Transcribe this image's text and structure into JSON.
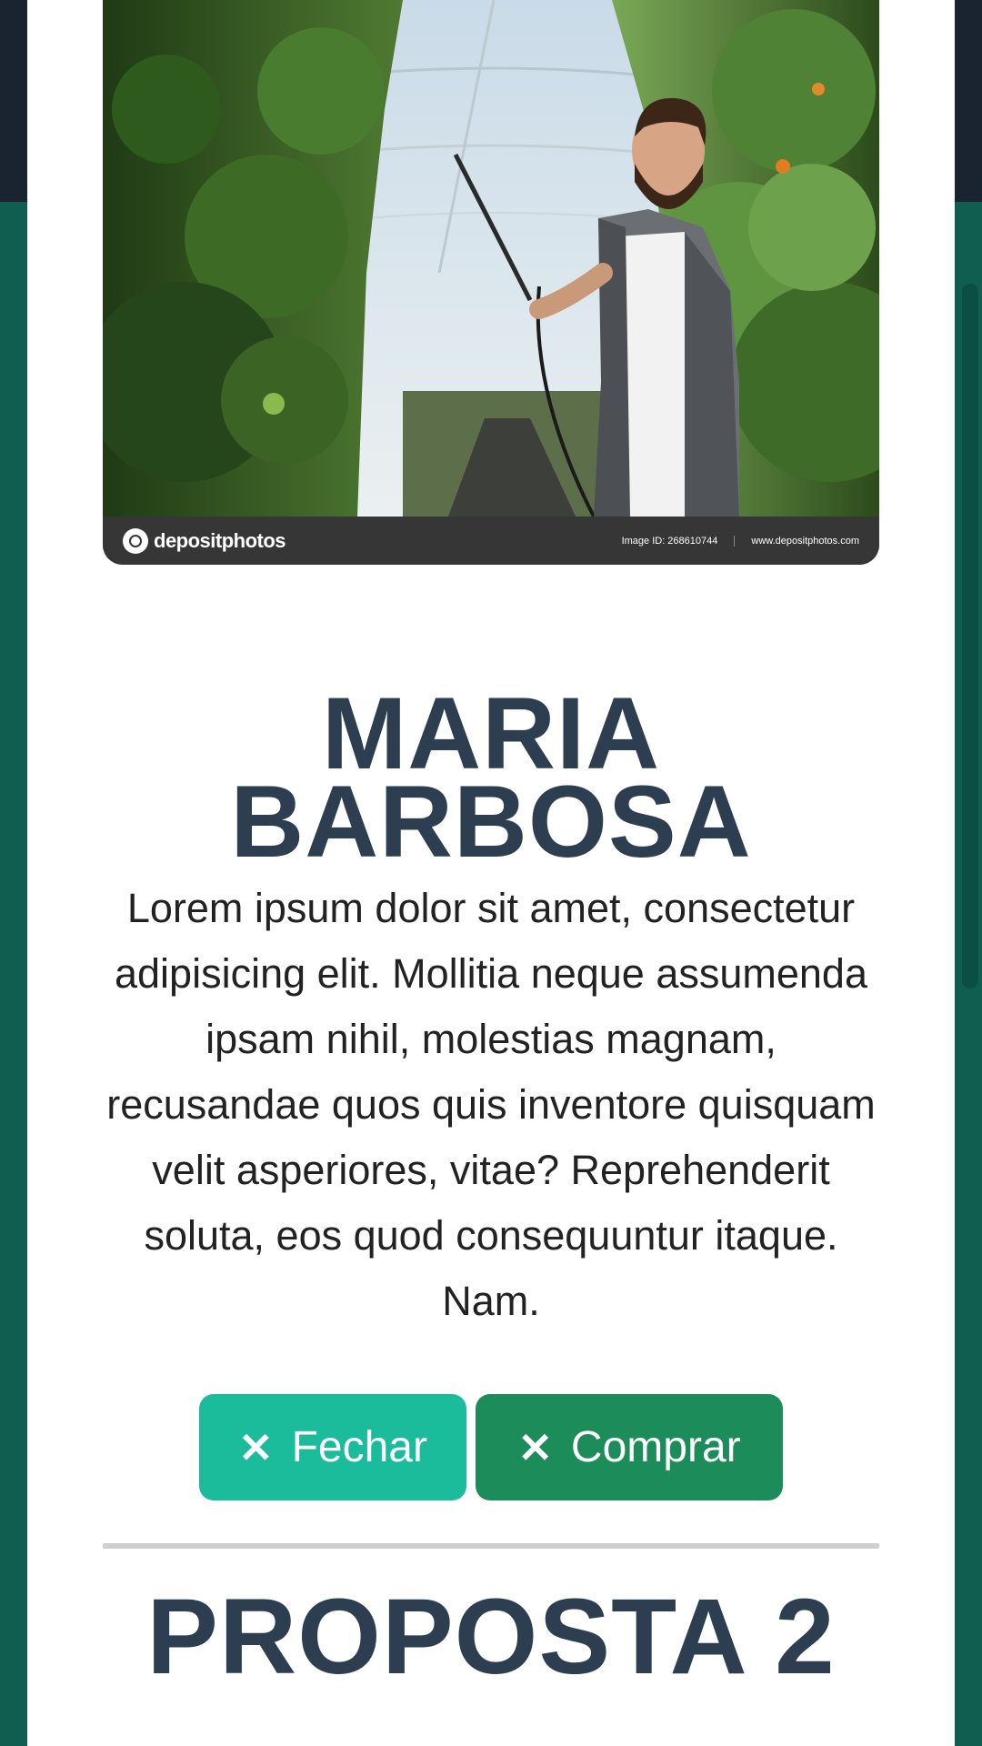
{
  "photo": {
    "brand": "depositphotos",
    "image_id": "Image ID: 268610744",
    "site": "www.depositphotos.com"
  },
  "profile": {
    "name_line1": "MARIA",
    "name_line2": "BARBOSA",
    "description": "Lorem ipsum dolor sit amet, consectetur adipisicing elit. Mollitia neque assumenda ipsam nihil, molestias magnam, recusandae quos quis inventore quisquam velit asperiores, vitae? Reprehenderit soluta, eos quod consequuntur itaque. Nam."
  },
  "actions": {
    "close_label": "Fechar",
    "buy_label": "Comprar",
    "close_icon": "times-icon",
    "buy_icon": "times-icon"
  },
  "next_section": {
    "title": "PROPOSTA 2"
  },
  "colors": {
    "title": "#2c3e50",
    "close_button": "#1abc9c",
    "buy_button": "#1b8c5a",
    "backdrop": "#0f5e50"
  }
}
